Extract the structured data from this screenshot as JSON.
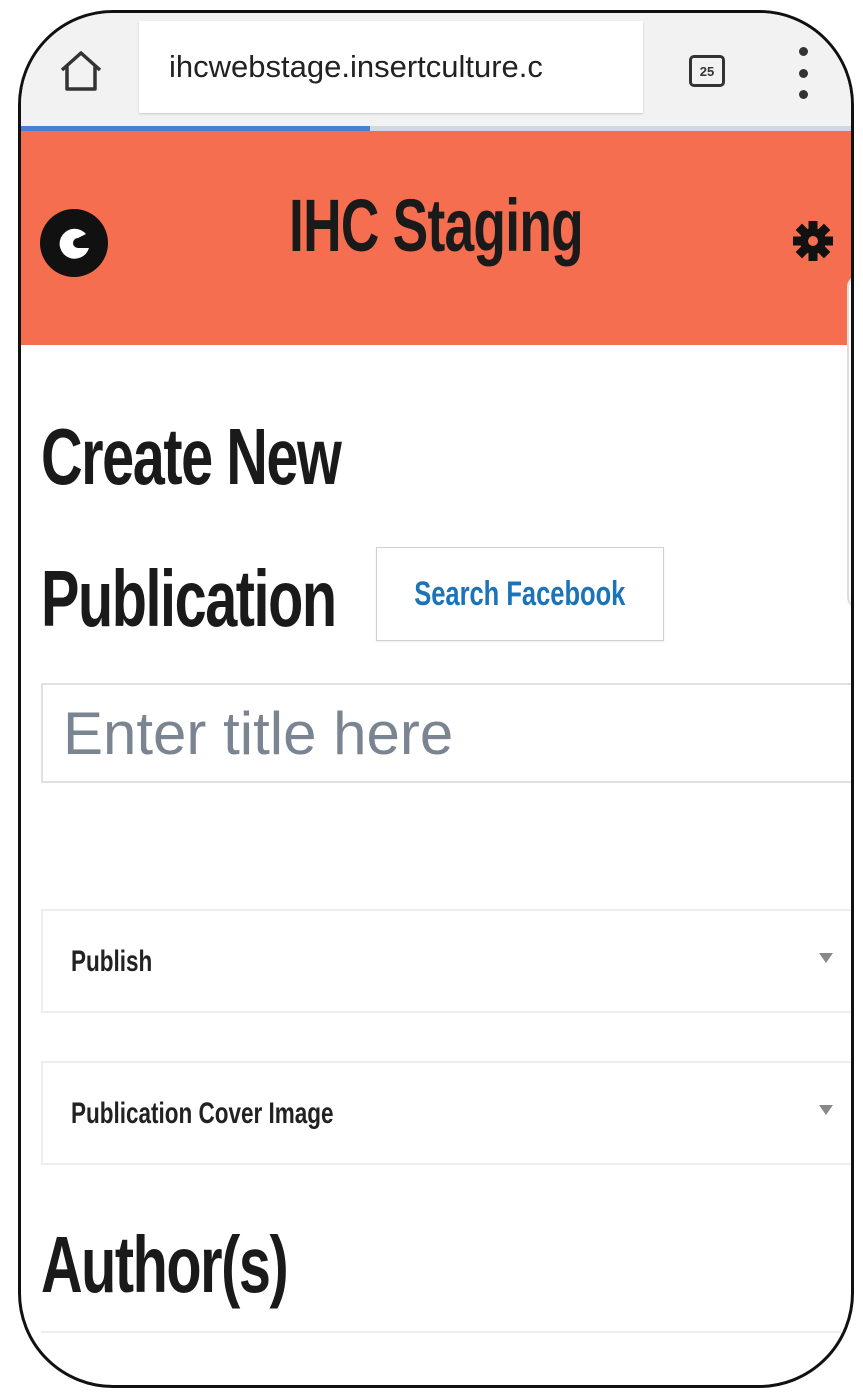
{
  "browser": {
    "home_icon": "home-icon",
    "url": "ihcwebstage.insertculture.c",
    "tab_count": "25",
    "menu_icon": "overflow-menu-icon",
    "load_progress": 0.42
  },
  "header": {
    "logo_icon": "brand-logo-icon",
    "title": "IHC Staging",
    "settings_icon": "gear-icon",
    "background_color": "#f56e50"
  },
  "page": {
    "heading_line1": "Create New",
    "heading_line2": "Publication",
    "search_facebook_label": "Search Facebook",
    "title_placeholder": "Enter title here",
    "panels": [
      {
        "label": "Publish"
      },
      {
        "label": "Publication Cover Image"
      }
    ],
    "authors_heading": "Author(s)"
  },
  "colors": {
    "accent": "#f56e50",
    "link": "#1b73b9",
    "progress": "#4a7fd6"
  }
}
